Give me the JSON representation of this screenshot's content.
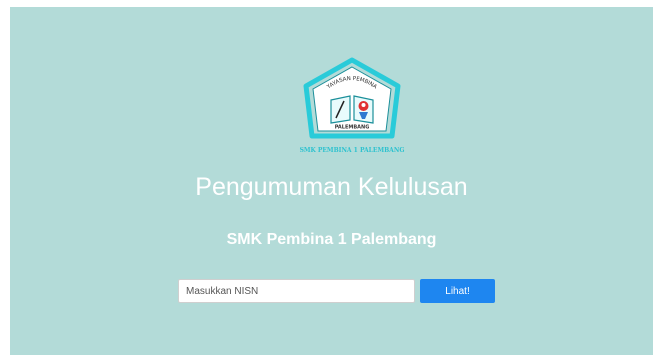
{
  "logo": {
    "ring_text": "YAYASAN PEMBINA",
    "city_text": "PALEMBANG",
    "caption": "SMK PEMBINA 1 PALEMBANG"
  },
  "header": {
    "title": "Pengumuman Kelulusan",
    "subtitle": "SMK Pembina 1 Palembang"
  },
  "search": {
    "placeholder": "Masukkan NISN",
    "button_label": "Lihat!"
  },
  "colors": {
    "background": "#b3dbd8",
    "button": "#1e86f0",
    "logo_outline": "#29cbd9"
  }
}
